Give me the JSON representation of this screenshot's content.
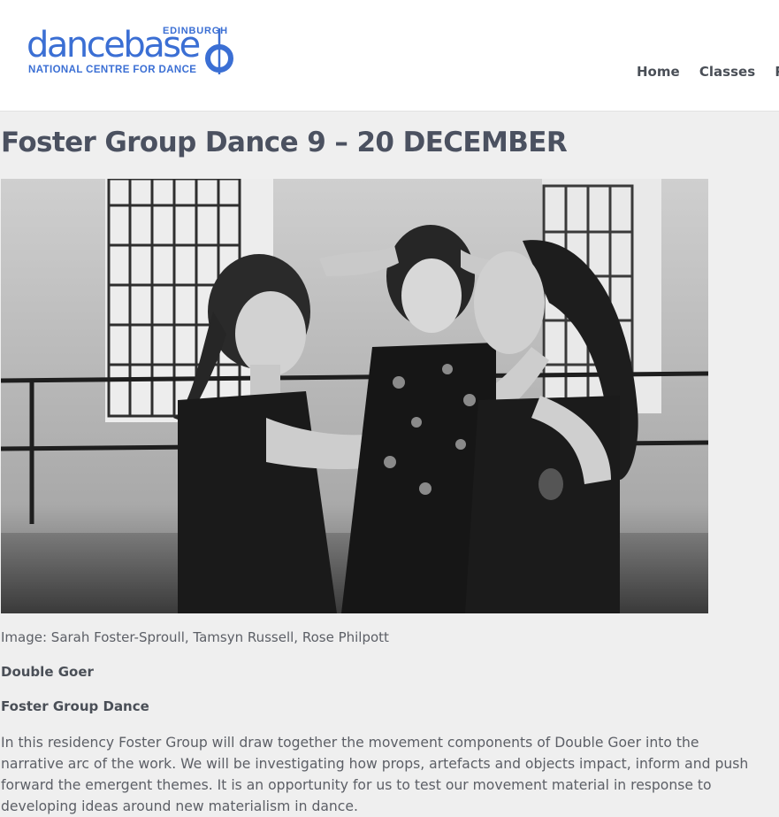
{
  "brand": {
    "city": "EDINBURGH",
    "name": "dancebase",
    "tagline": "NATIONAL CENTRE FOR DANCE",
    "color": "#3b6fd4"
  },
  "nav": {
    "items": [
      "Home",
      "Classes",
      "Pr"
    ]
  },
  "page": {
    "title": "Foster Group Dance 9 – 20 DECEMBER",
    "image_alt": "Three dancers in a rehearsal studio, black and white photograph",
    "caption": "Image: Sarah Foster-Sproull, Tamsyn Russell, Rose Philpott",
    "show_name": "Double Goer",
    "company": "Foster Group Dance",
    "description": "In this residency Foster Group will draw together the movement components of Double Goer into the narrative arc of the work. We will be investigating how props, artefacts and objects impact, inform and push forward the emergent themes. It is an opportunity for us to test our movement material in response to developing ideas around new materialism in dance."
  },
  "colors": {
    "page_bg": "#efefef",
    "header_bg": "#ffffff",
    "heading": "#4b5160",
    "text": "#5c5f66"
  }
}
